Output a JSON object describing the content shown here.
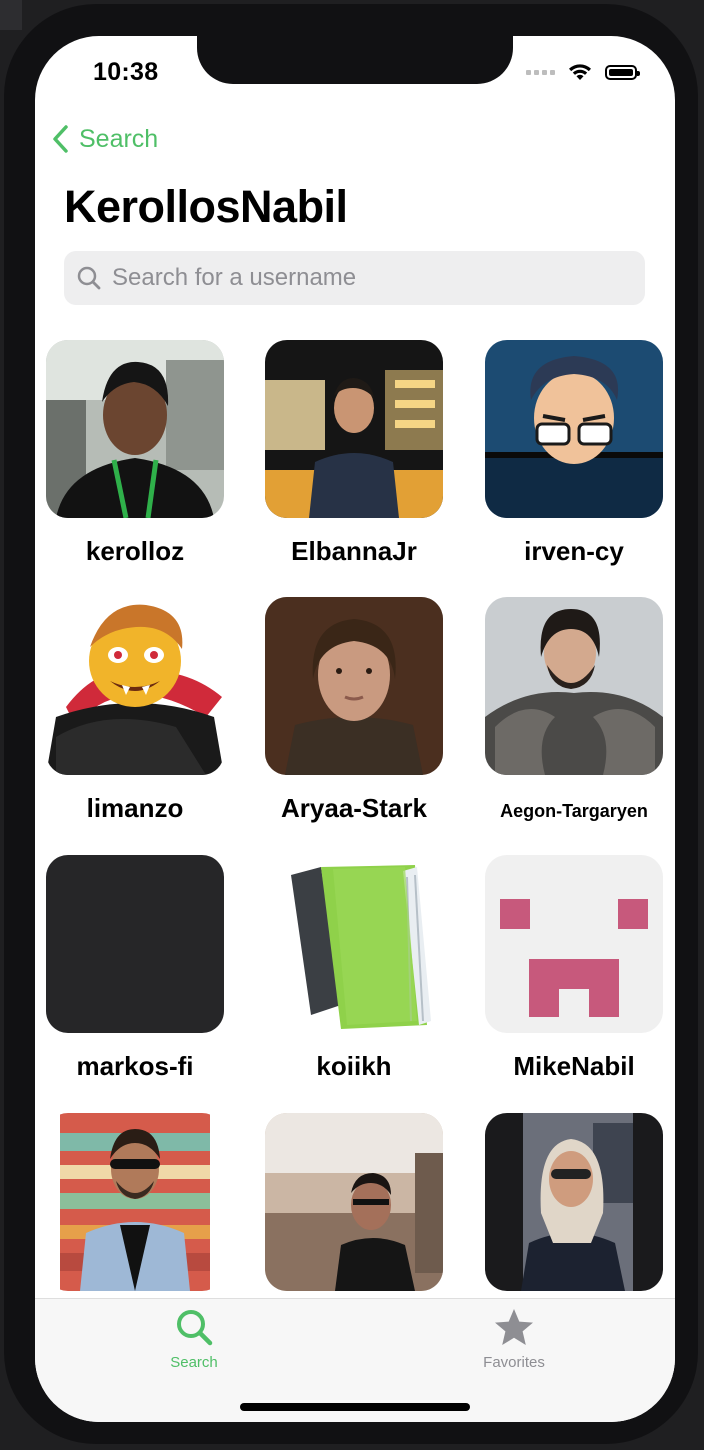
{
  "status": {
    "time": "10:38"
  },
  "nav": {
    "back_label": "Search",
    "title": "KerollosNabil"
  },
  "search": {
    "placeholder": "Search for a username"
  },
  "colors": {
    "accent": "#4fbf67",
    "inactive": "#8e8e93"
  },
  "users": [
    {
      "username": "kerolloz"
    },
    {
      "username": "ElbannaJr"
    },
    {
      "username": "irven-cy"
    },
    {
      "username": "limanzo"
    },
    {
      "username": "Aryaa-Stark"
    },
    {
      "username": "Aegon-Targaryen"
    },
    {
      "username": "markos-fi"
    },
    {
      "username": "koiikh"
    },
    {
      "username": "MikeNabil"
    },
    {
      "username": ""
    },
    {
      "username": ""
    },
    {
      "username": ""
    }
  ],
  "tabs": [
    {
      "label": "Search",
      "icon": "magnifier-icon",
      "active": true
    },
    {
      "label": "Favorites",
      "icon": "star-icon",
      "active": false
    }
  ]
}
